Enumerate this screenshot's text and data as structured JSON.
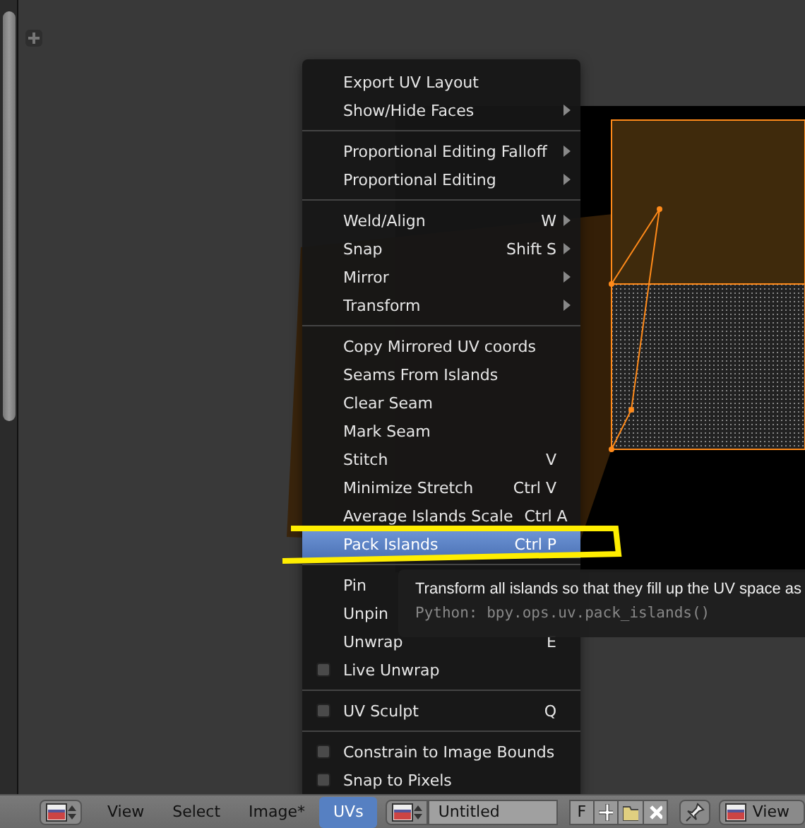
{
  "menu": {
    "sections": [
      [
        {
          "kind": "action",
          "label": "Export UV Layout",
          "submenu": false,
          "selected": false
        },
        {
          "kind": "action",
          "label": "Show/Hide Faces",
          "submenu": true,
          "selected": false
        }
      ],
      [
        {
          "kind": "action",
          "label": "Proportional Editing Falloff",
          "submenu": true,
          "selected": false
        },
        {
          "kind": "action",
          "label": "Proportional Editing",
          "submenu": true,
          "selected": false
        }
      ],
      [
        {
          "kind": "action",
          "label": "Weld/Align",
          "shortcut": "W",
          "submenu": true,
          "selected": false
        },
        {
          "kind": "action",
          "label": "Snap",
          "shortcut": "Shift S",
          "submenu": true,
          "selected": false
        },
        {
          "kind": "action",
          "label": "Mirror",
          "submenu": true,
          "selected": false
        },
        {
          "kind": "action",
          "label": "Transform",
          "submenu": true,
          "selected": false
        }
      ],
      [
        {
          "kind": "action",
          "label": "Copy Mirrored UV coords",
          "submenu": false,
          "selected": false
        },
        {
          "kind": "action",
          "label": "Seams From Islands",
          "submenu": false,
          "selected": false
        },
        {
          "kind": "action",
          "label": "Clear Seam",
          "submenu": false,
          "selected": false
        },
        {
          "kind": "action",
          "label": "Mark Seam",
          "submenu": false,
          "selected": false
        },
        {
          "kind": "action",
          "label": "Stitch",
          "shortcut": "V",
          "submenu": false,
          "selected": false
        },
        {
          "kind": "action",
          "label": "Minimize Stretch",
          "shortcut": "Ctrl V",
          "submenu": false,
          "selected": false
        },
        {
          "kind": "action",
          "label": "Average Islands Scale",
          "shortcut": "Ctrl A",
          "submenu": false,
          "selected": false
        },
        {
          "kind": "action",
          "label": "Pack Islands",
          "shortcut": "Ctrl P",
          "submenu": false,
          "selected": true
        }
      ],
      [
        {
          "kind": "action",
          "label": "Pin",
          "submenu": false,
          "selected": false
        },
        {
          "kind": "action",
          "label": "Unpin",
          "submenu": false,
          "selected": false
        },
        {
          "kind": "action",
          "label": "Unwrap",
          "shortcut": "E",
          "submenu": false,
          "selected": false
        },
        {
          "kind": "toggle",
          "label": "Live Unwrap",
          "checked": false,
          "selected": false
        }
      ],
      [
        {
          "kind": "toggle",
          "label": "UV Sculpt",
          "shortcut": "Q",
          "checked": false,
          "selected": false
        }
      ],
      [
        {
          "kind": "toggle",
          "label": "Constrain to Image Bounds",
          "checked": false,
          "selected": false
        },
        {
          "kind": "toggle",
          "label": "Snap to Pixels",
          "checked": false,
          "selected": false
        }
      ]
    ]
  },
  "tooltip": {
    "text": "Transform all islands so that they fill up the UV space as",
    "python": "Python: bpy.ops.uv.pack_islands()"
  },
  "header": {
    "menus": [
      {
        "label": "View",
        "selected": false
      },
      {
        "label": "Select",
        "selected": false
      },
      {
        "label": "Image*",
        "selected": false
      },
      {
        "label": "UVs",
        "selected": true
      }
    ],
    "image_name": "Untitled",
    "fake_user": "F",
    "view_menu": "View"
  }
}
